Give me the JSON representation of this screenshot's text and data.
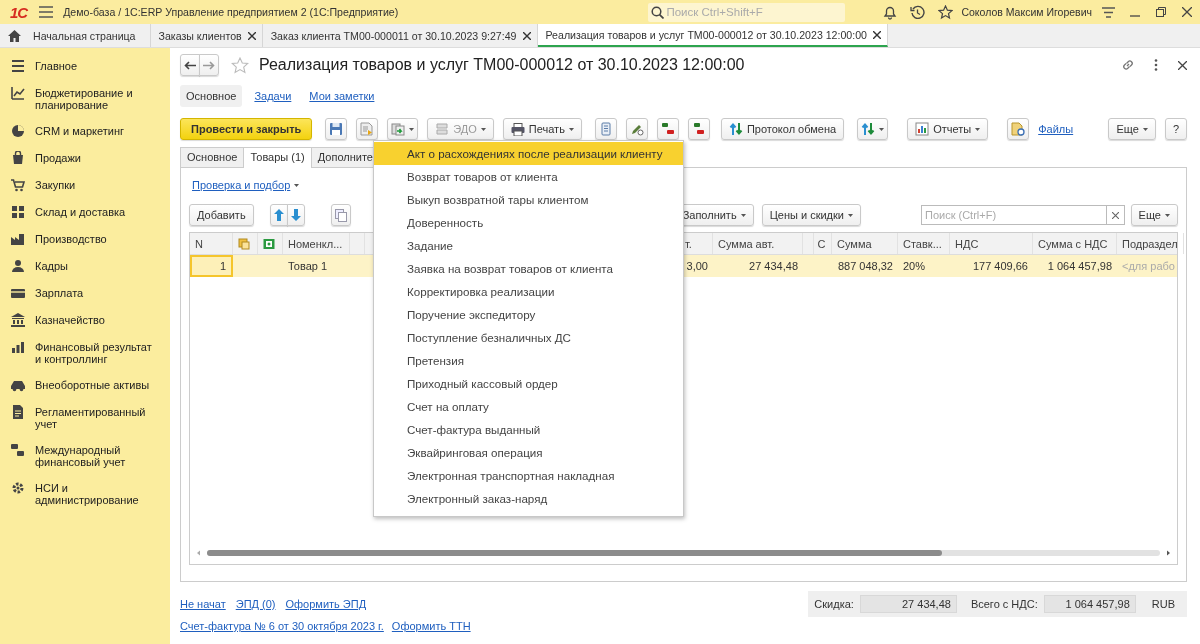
{
  "app": {
    "logo": "1С",
    "title": "Демо-база / 1С:ERP Управление предприятием 2  (1С:Предприятие)",
    "search": {
      "placeholder": "Поиск Ctrl+Shift+F"
    },
    "user": "Соколов Максим Игоревич"
  },
  "tabs": [
    {
      "kind": "home",
      "label": "Начальная страница",
      "selected": false
    },
    {
      "kind": "doc",
      "label": "Заказы клиентов",
      "selected": false
    },
    {
      "kind": "doc",
      "label": "Заказ клиента ТМ00-000011 от 30.10.2023 9:27:49",
      "selected": false
    },
    {
      "kind": "doc",
      "label": "Реализация товаров и услуг ТМ00-000012 от 30.10.2023 12:00:00",
      "selected": true
    }
  ],
  "sidebar": {
    "items": [
      "Главное",
      "Бюджетирование и планирование",
      "CRM и маркетинг",
      "Продажи",
      "Закупки",
      "Склад и доставка",
      "Производство",
      "Кадры",
      "Зарплата",
      "Казначейство",
      "Финансовый результат и контроллинг",
      "Внеоборотные активы",
      "Регламентированный учет",
      "Международный финансовый учет",
      "НСИ и администрирование"
    ]
  },
  "form": {
    "title": "Реализация товаров и услуг ТМ00-000012 от 30.10.2023 12:00:00",
    "nav": [
      {
        "label": "Основное",
        "selected": true
      },
      {
        "label": "Задачи",
        "selected": false
      },
      {
        "label": "Мои заметки",
        "selected": false
      }
    ],
    "toolbar": [
      {
        "kind": "primary",
        "label": "Провести и закрыть"
      },
      {
        "kind": "icon"
      },
      {
        "kind": "icon"
      },
      {
        "kind": "icon-menu"
      },
      {
        "kind": "menu",
        "label": "ЭДО",
        "disabled": true
      },
      {
        "kind": "menu",
        "label": "Печать",
        "disabled": false
      },
      {
        "kind": "icon"
      },
      {
        "kind": "icon"
      },
      {
        "kind": "icon"
      },
      {
        "kind": "icon"
      },
      {
        "kind": "button",
        "label": "Протокол обмена"
      },
      {
        "kind": "icon-menu"
      },
      {
        "kind": "menu",
        "label": "Отчеты",
        "disabled": false
      },
      {
        "kind": "icon"
      },
      {
        "kind": "link",
        "label": "Файлы"
      }
    ],
    "toolbar_right": [
      {
        "kind": "menu",
        "label": "Еще",
        "disabled": false
      },
      {
        "kind": "button",
        "label": "?"
      }
    ],
    "inner_tabs": [
      {
        "label": "Основное",
        "selected": false
      },
      {
        "label": "Товары (1)",
        "selected": true
      },
      {
        "label": "Дополните",
        "selected": false
      }
    ],
    "check_link": "Проверка и подбор",
    "table_toolbar": {
      "add": "Добавить",
      "fill": "Заполнить",
      "prices": "Цены и скидки",
      "search": {
        "placeholder": "Поиск (Ctrl+F)"
      },
      "more": "Еще"
    },
    "table": {
      "columns": [
        "N",
        null,
        null,
        "Номенкл...",
        null,
        null,
        "т.",
        "Сумма авт.",
        null,
        "С",
        "Сумма",
        "Ставк...",
        "НДС",
        "Сумма с НДС",
        "Подраздел"
      ],
      "rows": [
        {
          "selected": true,
          "cells": [
            "1",
            null,
            null,
            "Товар 1",
            null,
            null,
            "3,00",
            "27 434,48",
            null,
            null,
            "887 048,32",
            "20%",
            "177 409,66",
            "1 064 457,98",
            "<для рабо"
          ]
        }
      ]
    },
    "menu": {
      "items": [
        {
          "label": "Акт о расхождениях после реализации клиенту",
          "selected": true
        },
        {
          "label": "Возврат товаров от клиента",
          "selected": false
        },
        {
          "label": "Выкуп возвратной тары клиентом",
          "selected": false
        },
        {
          "label": "Доверенность",
          "selected": false
        },
        {
          "label": "Задание",
          "selected": false
        },
        {
          "label": "Заявка на возврат товаров от клиента",
          "selected": false
        },
        {
          "label": "Корректировка реализации",
          "selected": false
        },
        {
          "label": "Поручение экспедитору",
          "selected": false
        },
        {
          "label": "Поступление безналичных ДС",
          "selected": false
        },
        {
          "label": "Претензия",
          "selected": false
        },
        {
          "label": "Приходный кассовый ордер",
          "selected": false
        },
        {
          "label": "Счет на оплату",
          "selected": false
        },
        {
          "label": "Счет-фактура выданный",
          "selected": false
        },
        {
          "label": "Эквайринговая операция",
          "selected": false
        },
        {
          "label": "Электронная транспортная накладная",
          "selected": false
        },
        {
          "label": "Электронный заказ-наряд",
          "selected": false
        }
      ]
    },
    "footer": {
      "links": [
        "Не начат",
        "ЭПД (0)",
        "Оформить ЭПД"
      ],
      "totals": [
        {
          "label": "Скидка:",
          "value": "27 434,48"
        },
        {
          "label": "Всего с НДС:",
          "value": "1 064 457,98"
        }
      ],
      "currency": "RUB",
      "links2": [
        "Счет-фактура № 6 от 30 октября 2023 г.",
        "Оформить ТТН"
      ]
    }
  }
}
